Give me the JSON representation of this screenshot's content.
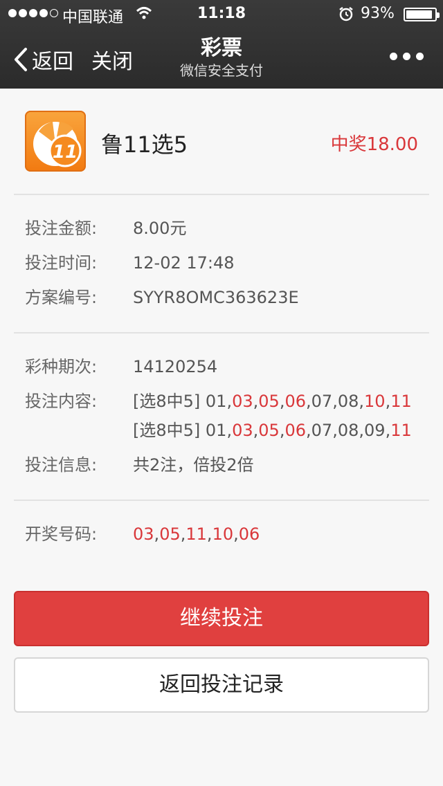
{
  "status_bar": {
    "carrier": "中国联通",
    "time": "11:18",
    "battery_pct_text": "93%",
    "battery_level": 0.93
  },
  "nav": {
    "back_label": "返回",
    "close_label": "关闭",
    "title": "彩票",
    "subtitle": "微信安全支付"
  },
  "ticket": {
    "name": "鲁11选5",
    "win_text": "中奖18.00",
    "app_icon_text": "11"
  },
  "bet_info": {
    "amount_label": "投注金额:",
    "amount_value": "8.00元",
    "time_label": "投注时间:",
    "time_value": "12-02 17:48",
    "scheme_label": "方案编号:",
    "scheme_value": "SYYR8OMC363623E"
  },
  "draw_info": {
    "period_label": "彩种期次:",
    "period_value": "14120254",
    "content_label": "投注内容:",
    "lines": [
      {
        "prefix": "[选8中5] ",
        "numbers": [
          {
            "n": "01",
            "hit": false
          },
          {
            "n": "03",
            "hit": true
          },
          {
            "n": "05",
            "hit": true
          },
          {
            "n": "06",
            "hit": true
          },
          {
            "n": "07",
            "hit": false
          },
          {
            "n": "08",
            "hit": false
          },
          {
            "n": "10",
            "hit": true
          },
          {
            "n": "11",
            "hit": true
          }
        ]
      },
      {
        "prefix": "[选8中5] ",
        "numbers": [
          {
            "n": "01",
            "hit": false
          },
          {
            "n": "03",
            "hit": true
          },
          {
            "n": "05",
            "hit": true
          },
          {
            "n": "06",
            "hit": true
          },
          {
            "n": "07",
            "hit": false
          },
          {
            "n": "08",
            "hit": false
          },
          {
            "n": "09",
            "hit": false
          },
          {
            "n": "11",
            "hit": true
          }
        ]
      }
    ],
    "bet_detail_label": "投注信息:",
    "bet_detail_value": "共2注，倍投2倍"
  },
  "result": {
    "label": "开奖号码:",
    "numbers": [
      "03",
      "05",
      "11",
      "10",
      "06"
    ]
  },
  "buttons": {
    "continue_label": "继续投注",
    "back_records_label": "返回投注记录"
  },
  "colors": {
    "accent_red": "#d9373a",
    "primary_button": "#e0403f",
    "header_bg": "#2f2f2f"
  }
}
